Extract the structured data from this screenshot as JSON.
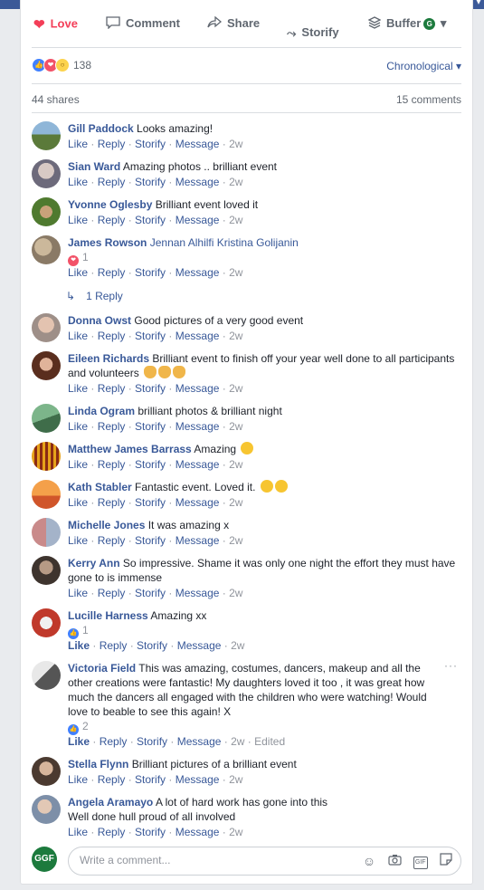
{
  "actions": {
    "love": "Love",
    "comment": "Comment",
    "share": "Share",
    "storify": "Storify",
    "buffer": "Buffer",
    "buffer_badge": "GGF"
  },
  "summary": {
    "reaction_count": "138",
    "sort": "Chronological"
  },
  "shares": "44 shares",
  "comments_count": "15 comments",
  "comment_actions": {
    "like": "Like",
    "reply": "Reply",
    "storify": "Storify",
    "message": "Message",
    "sep": "·"
  },
  "comments": [
    {
      "name": "Gill Paddock",
      "text": "Looks amazing!",
      "time": "2w"
    },
    {
      "name": "Sian Ward",
      "text": "Amazing photos .. brilliant event",
      "time": "2w"
    },
    {
      "name": "Yvonne Oglesby",
      "text": "Brilliant event loved it",
      "time": "2w"
    },
    {
      "name": "James Rowson",
      "text": "Jennan Alhilfi Kristina Golijanin",
      "reactions": "1",
      "time": "2w"
    },
    {
      "name": "Donna Owst",
      "text": "Good pictures of a very good event",
      "time": "2w"
    },
    {
      "name": "Eileen Richards",
      "text": "Brilliant event to finish off your year well done to all participants and volunteers",
      "time": "2w"
    },
    {
      "name": "Linda Ogram",
      "text": "brilliant photos & brilliant night",
      "time": "2w"
    },
    {
      "name": "Matthew James Barrass",
      "text": "Amazing",
      "time": "2w"
    },
    {
      "name": "Kath Stabler",
      "text": "Fantastic event. Loved it.",
      "time": "2w"
    },
    {
      "name": "Michelle Jones",
      "text": "It was amazing x",
      "time": "2w"
    },
    {
      "name": "Kerry Ann",
      "text": "So impressive. Shame it was only one night the effort they must have gone to is immense",
      "time": "2w"
    },
    {
      "name": "Lucille Harness",
      "text": "Amazing xx",
      "reactions": "1",
      "time": "2w"
    },
    {
      "name": "Victoria Field",
      "text": "This was amazing, costumes, dancers, makeup and all the other creations were fantastic! My daughters loved it too , it was great how much the dancers all engaged with the children who were watching! Would love to beable to see this again! X",
      "reactions": "2",
      "time": "2w",
      "edited": "Edited"
    },
    {
      "name": "Stella Flynn",
      "text": "Brilliant pictures of a brilliant event",
      "time": "2w"
    },
    {
      "name": "Angela Aramayo",
      "text": "A lot of hard work has gone into this Well done hull proud of all involved",
      "time": "2w"
    }
  ],
  "reply_link": "1 Reply",
  "composer": {
    "avatar_text": "GGF",
    "placeholder": "Write a comment..."
  },
  "colors": {
    "link": "#385898",
    "love": "#f33e58",
    "header": "#3b5998",
    "page_avatar": "#1c7a3d"
  },
  "icons": [
    "heart-icon",
    "comment-icon",
    "share-icon",
    "storify-icon",
    "buffer-icon",
    "search-icon",
    "reply-arrow-icon",
    "emoji-icon",
    "camera-icon",
    "gif-icon",
    "sticker-icon"
  ]
}
